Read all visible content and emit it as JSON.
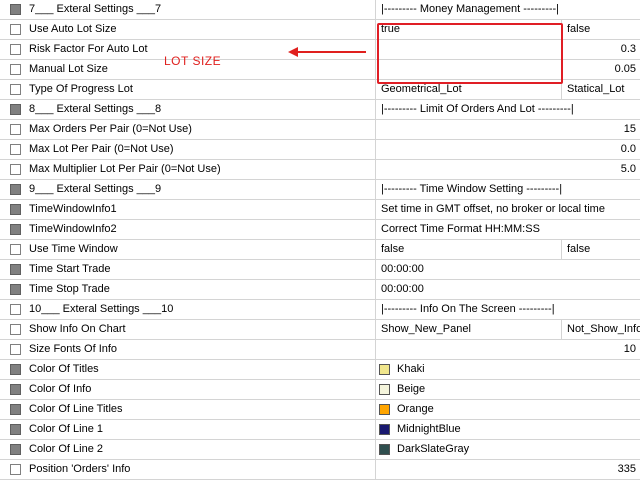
{
  "rows": [
    {
      "icon": "sq",
      "label": "7___ Exteral Settings ___7",
      "type": "sep",
      "value": "|--------- Money Management ---------|"
    },
    {
      "icon": "check",
      "label": "Use Auto Lot Size",
      "type": "opt",
      "value": "true",
      "extra": "false"
    },
    {
      "icon": "check",
      "label": "Risk Factor For Auto Lot",
      "type": "num",
      "value": "0.3"
    },
    {
      "icon": "check",
      "label": "Manual Lot Size",
      "type": "num",
      "value": "0.05"
    },
    {
      "icon": "check",
      "label": "Type Of Progress Lot",
      "type": "opt",
      "value": "Geometrical_Lot",
      "extra": "Statical_Lot"
    },
    {
      "icon": "sq",
      "label": "8___ Exteral Settings ___8",
      "type": "sep",
      "value": "|--------- Limit Of Orders And Lot ---------|"
    },
    {
      "icon": "check",
      "label": "Max Orders Per Pair (0=Not Use)",
      "type": "num",
      "value": "15"
    },
    {
      "icon": "check",
      "label": "Max Lot Per Pair (0=Not Use)",
      "type": "num",
      "value": "0.0"
    },
    {
      "icon": "check",
      "label": "Max Multiplier Lot Per Pair (0=Not Use)",
      "type": "num",
      "value": "5.0"
    },
    {
      "icon": "sq",
      "label": "9___ Exteral Settings ___9",
      "type": "sep",
      "value": "|--------- Time Window Setting ---------|"
    },
    {
      "icon": "sq",
      "label": "TimeWindowInfo1",
      "type": "text",
      "value": "Set time in GMT offset, no broker or local time"
    },
    {
      "icon": "sq",
      "label": "TimeWindowInfo2",
      "type": "text",
      "value": "Correct Time Format HH:MM:SS"
    },
    {
      "icon": "check",
      "label": "Use Time Window",
      "type": "opt",
      "value": "false",
      "extra": "false"
    },
    {
      "icon": "sq",
      "label": "Time Start Trade",
      "type": "text",
      "value": "00:00:00"
    },
    {
      "icon": "sq",
      "label": "Time Stop Trade",
      "type": "text",
      "value": "00:00:00"
    },
    {
      "icon": "check",
      "label": "10___ Exteral Settings ___10",
      "type": "sep",
      "value": "|--------- Info On The Screen ---------|"
    },
    {
      "icon": "check",
      "label": "Show Info On Chart",
      "type": "opt",
      "value": "Show_New_Panel",
      "extra": "Not_Show_Info"
    },
    {
      "icon": "check",
      "label": "Size Fonts Of Info",
      "type": "num",
      "value": "10"
    },
    {
      "icon": "sq",
      "label": "Color Of Titles",
      "type": "color",
      "value": "Khaki",
      "color": "#f0e68c"
    },
    {
      "icon": "sq",
      "label": "Color Of Info",
      "type": "color",
      "value": "Beige",
      "color": "#f5f5dc"
    },
    {
      "icon": "sq",
      "label": "Color Of Line Titles",
      "type": "color",
      "value": "Orange",
      "color": "#ffa500"
    },
    {
      "icon": "sq",
      "label": "Color Of Line 1",
      "type": "color",
      "value": "MidnightBlue",
      "color": "#191970"
    },
    {
      "icon": "sq",
      "label": "Color Of Line 2",
      "type": "color",
      "value": "DarkSlateGray",
      "color": "#2f4f4f"
    },
    {
      "icon": "check",
      "label": "Position 'Orders' Info",
      "type": "num",
      "value": "335"
    }
  ],
  "annotation": {
    "label": "LOT SIZE",
    "color": "#e0201e"
  }
}
